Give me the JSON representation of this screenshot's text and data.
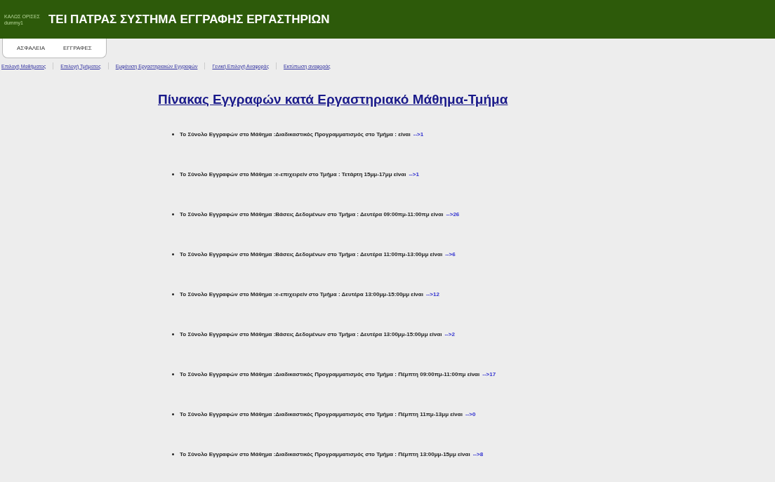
{
  "header": {
    "welcome": "ΚΑΛΩΣ ΟΡΙΣΕΣ",
    "user": "dummy1",
    "title": "ΤΕΙ ΠΑΤΡΑΣ ΣΥΣΤΗΜΑ ΕΓΓΡΑΦΗΣ ΕΡΓΑΣΤΗΡΙΩΝ"
  },
  "tabs": [
    {
      "label": "ΑΣΦΑΛΕΙΑ"
    },
    {
      "label": "ΕΓΓΡΑΦΕΣ"
    }
  ],
  "links": [
    "Επιλογή Μαθήματος",
    "Επιλογή Τμήματος",
    "Εμφάνιση Εργαστηριακών Εγγραφών",
    "Γενική Επιλογή Αναφοράς",
    "Εκτύπωση αναφοράς"
  ],
  "heading": "Πίνακας Εγγραφών κατά Εργαστηριακό Μάθημα-Τμήμα",
  "rows": [
    {
      "text": "Το Σύνολο Εγγραφών στο Μάθημα :Διαδικαστικός Προγραμματισμός στο Τμήμα : είναι",
      "count": "-->1"
    },
    {
      "text": "Το Σύνολο Εγγραφών στο Μάθημα :e-επιχειρείν στο Τμήμα : Τετάρτη 15μμ-17μμ είναι",
      "count": "-->1"
    },
    {
      "text": "Το Σύνολο Εγγραφών στο Μάθημα :Βάσεις Δεδομένων στο Τμήμα : Δευτέρα 09:00πμ-11:00πμ είναι",
      "count": "-->26"
    },
    {
      "text": "Το Σύνολο Εγγραφών στο Μάθημα :Βάσεις Δεδομένων στο Τμήμα : Δευτέρα 11:00πμ-13:00μμ είναι",
      "count": "-->6"
    },
    {
      "text": "Το Σύνολο Εγγραφών στο Μάθημα :e-επιχειρείν στο Τμήμα : Δευτέρα 13:00μμ-15:00μμ είναι",
      "count": "-->12"
    },
    {
      "text": "Το Σύνολο Εγγραφών στο Μάθημα :Βάσεις Δεδομένων στο Τμήμα : Δευτέρα 13:00μμ-15:00μμ είναι",
      "count": "-->2"
    },
    {
      "text": "Το Σύνολο Εγγραφών στο Μάθημα :Διαδικαστικός Προγραμματισμός στο Τμήμα : Πέμπτη 09:00πμ-11:00πμ είναι",
      "count": "-->17"
    },
    {
      "text": "Το Σύνολο Εγγραφών στο Μάθημα :Διαδικαστικός Προγραμματισμός στο Τμήμα : Πέμπτη 11πμ-13μμ είναι",
      "count": "-->0"
    },
    {
      "text": "Το Σύνολο Εγγραφών στο Μάθημα :Διαδικαστικός Προγραμματισμός στο Τμήμα : Πέμπτη 13:00μμ-15μμ είναι",
      "count": "-->8"
    }
  ]
}
